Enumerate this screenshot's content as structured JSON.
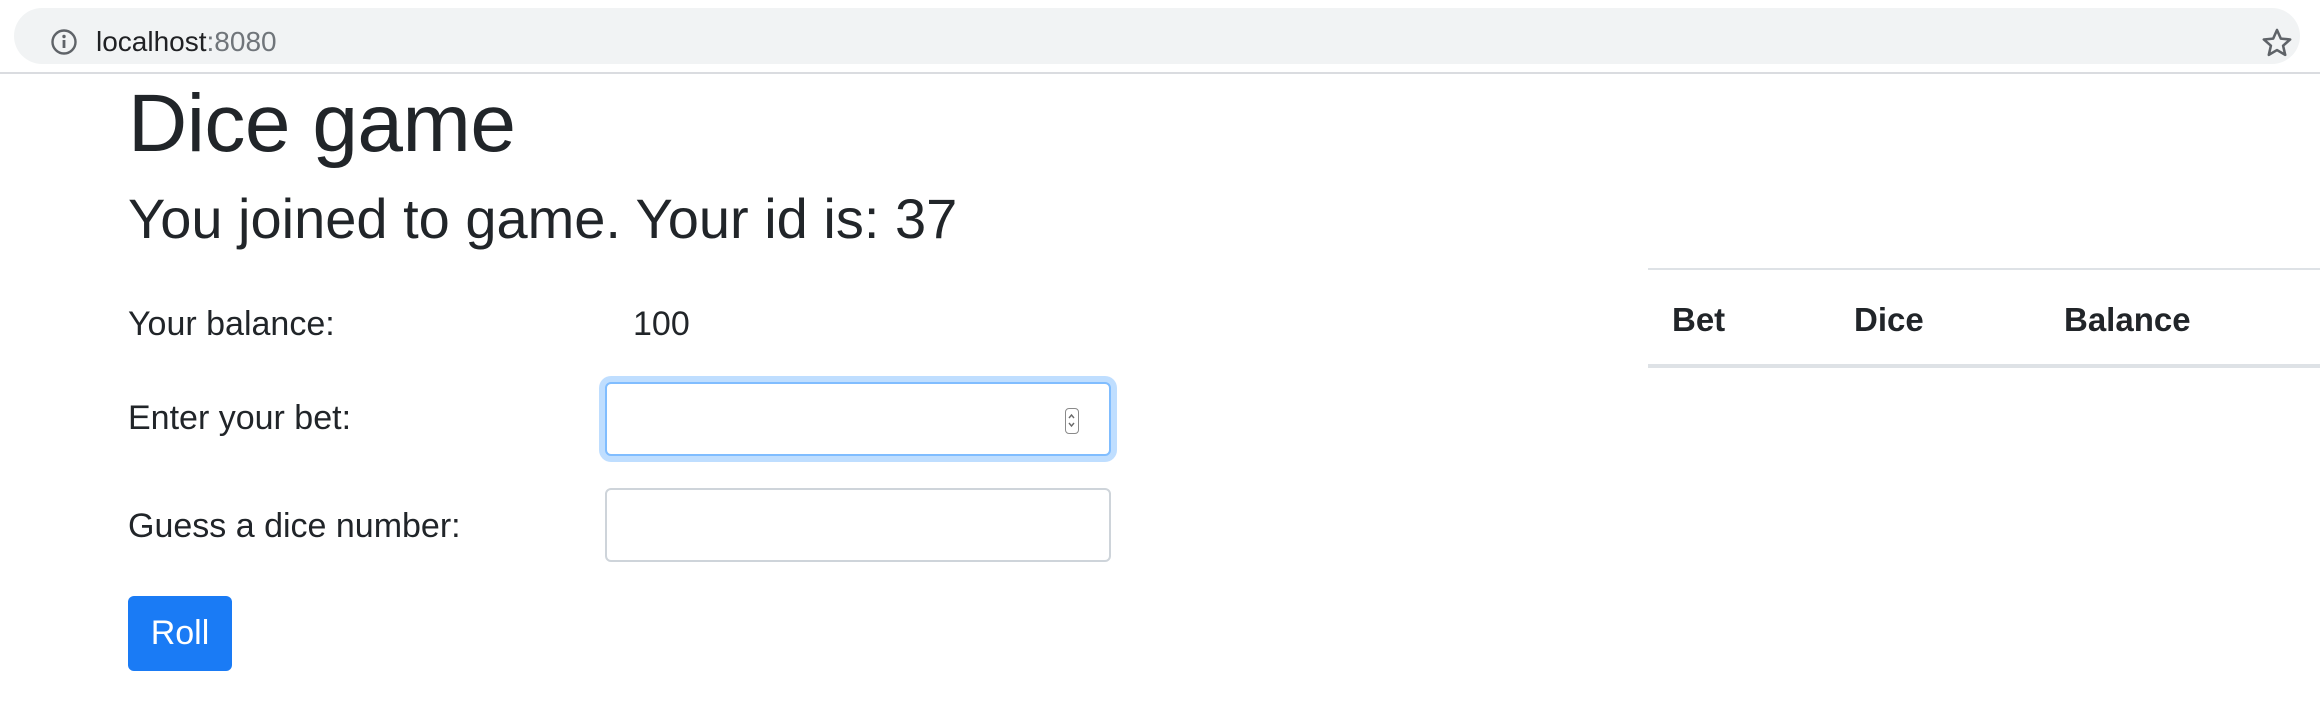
{
  "browser": {
    "url_host": "localhost",
    "url_port": ":8080"
  },
  "game": {
    "title": "Dice game",
    "joined_message": "You joined to game. Your id is: 37"
  },
  "form": {
    "balance_label": "Your balance:",
    "balance_value": "100",
    "bet_label": "Enter your bet:",
    "bet_value": "",
    "guess_label": "Guess a dice number:",
    "guess_value": "",
    "roll_label": "Roll"
  },
  "history": {
    "columns": [
      "Bet",
      "Dice",
      "Balance"
    ],
    "rows": []
  },
  "colors": {
    "primary": "#1a7bf5",
    "focus_ring": "#80bdff"
  }
}
